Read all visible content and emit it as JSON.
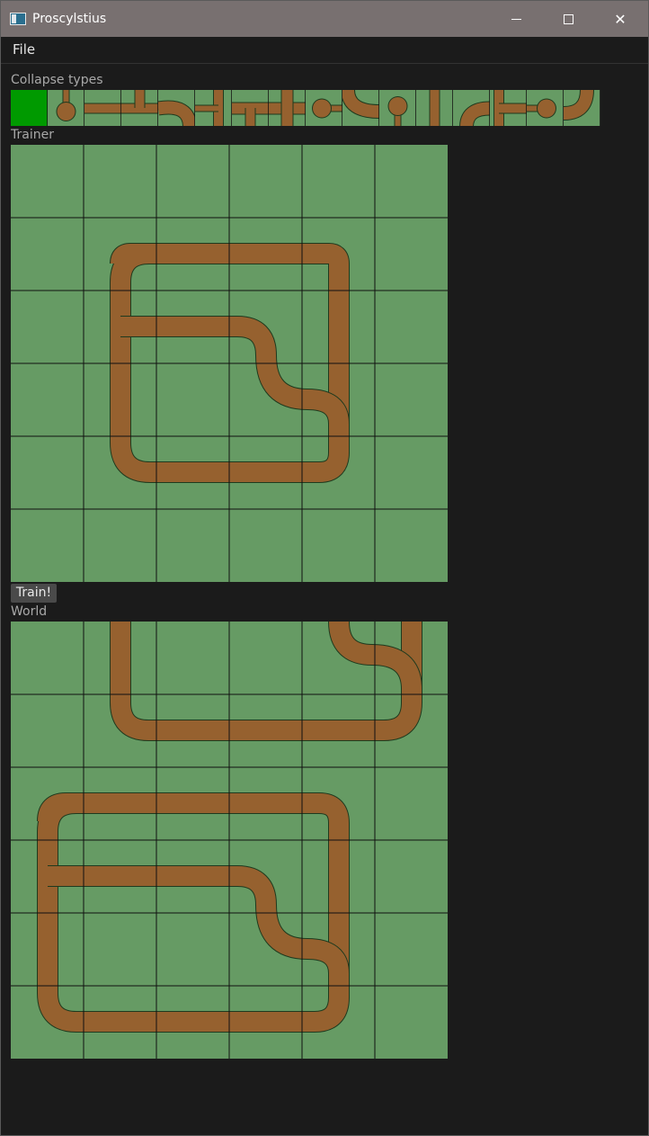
{
  "window": {
    "title": "Proscylstius",
    "minimize_icon": "minimize-icon",
    "maximize_icon": "maximize-icon",
    "close_glyph": "✕"
  },
  "menu": {
    "file": "File"
  },
  "collapse": {
    "label": "Collapse types",
    "selected_index": 0,
    "selected_color": "#009a00",
    "tile_count": 16
  },
  "trainer": {
    "label": "Trainer"
  },
  "train_button": {
    "label": "Train!"
  },
  "world": {
    "label": "World"
  },
  "colors": {
    "grass": "#669b64",
    "path": "#96612f",
    "outline": "#1e3a1e",
    "gridline": "#101010"
  }
}
